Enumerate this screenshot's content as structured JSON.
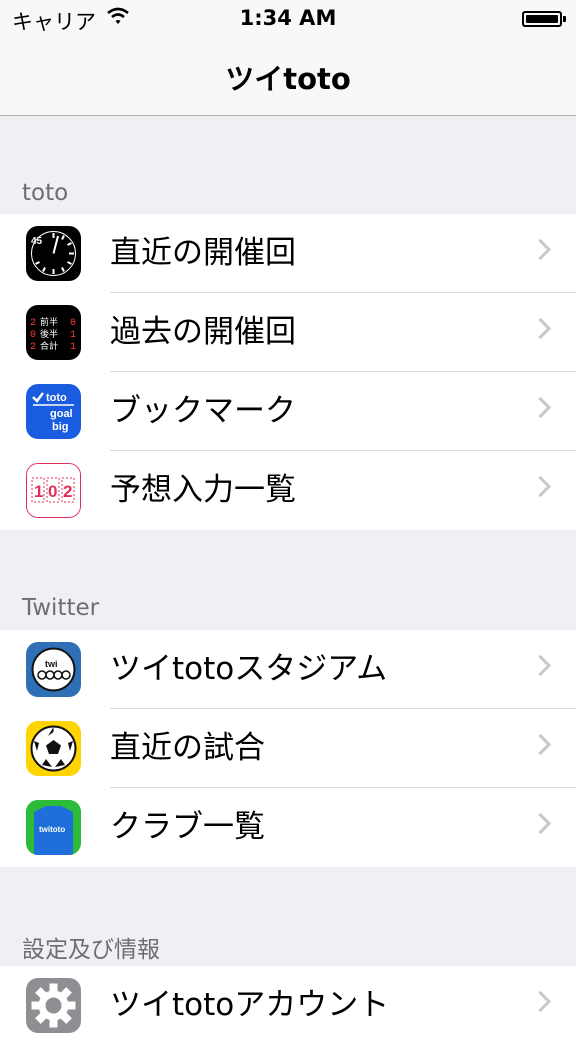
{
  "status_bar": {
    "carrier": "キャリア",
    "time": "1:34 AM"
  },
  "nav": {
    "title": "ツイtoto"
  },
  "sections": [
    {
      "header": "toto",
      "items": [
        {
          "label": "直近の開催回",
          "icon": "clock-icon"
        },
        {
          "label": "過去の開催回",
          "icon": "scoreboard-icon"
        },
        {
          "label": "ブックマーク",
          "icon": "bookmark-icon"
        },
        {
          "label": "予想入力一覧",
          "icon": "prediction-counter-icon"
        }
      ]
    },
    {
      "header": "Twitter",
      "items": [
        {
          "label": "ツイtotoスタジアム",
          "icon": "stadium-icon"
        },
        {
          "label": "直近の試合",
          "icon": "soccer-ball-icon"
        },
        {
          "label": "クラブ一覧",
          "icon": "jersey-icon"
        }
      ]
    },
    {
      "header": "設定及び情報",
      "items": [
        {
          "label": "ツイtotoアカウント",
          "icon": "gear-icon"
        }
      ]
    }
  ],
  "icon_text": {
    "clock_number": "45",
    "scoreboard": [
      "前半",
      "後半",
      "合計"
    ],
    "bookmark": [
      "toto",
      "goal",
      "big"
    ],
    "counter": [
      "1",
      "0",
      "2"
    ],
    "stadium": "twi",
    "jersey": "twitoto"
  },
  "colors": {
    "bookmark_blue": "#1a5ce0",
    "counter_red": "#e0305a",
    "stadium_blue": "#2f6fb5",
    "ball_yellow": "#ffd400",
    "jersey_blue": "#1e6fd9",
    "jersey_green": "#2dbb3a",
    "gear_gray": "#8e8e93"
  }
}
